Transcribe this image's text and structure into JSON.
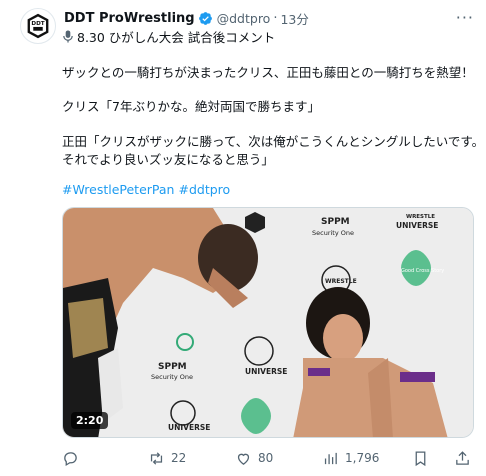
{
  "tweet": {
    "author_name": "DDT ProWrestling",
    "handle": "@ddtpro",
    "separator": "·",
    "time": "13分",
    "space_line": "8.30 ひがしん大会 試合後コメント",
    "lines": [
      "ザックとの一騎打ちが決まったクリス、正田も藤田との一騎打ちを熱望！",
      "クリス「7年ぶりかな。絶対両国で勝ちます」",
      "正田「クリスがザックに勝って、次は俺がこうくんとシングルしたいです。",
      "それでより良いズッ友になると思う」"
    ],
    "hashtags": [
      "#WrestlePeterPan",
      "#ddtpro"
    ],
    "video": {
      "duration": "2:20",
      "banner_texts": [
        "SPPM",
        "Security One",
        "WRESTLE",
        "UNIVERSE",
        "Good Cross Story"
      ]
    },
    "actions": {
      "reply_count": "",
      "retweet_count": "22",
      "like_count": "80",
      "views_count": "1,796"
    },
    "colors": {
      "link": "#1d9bf0",
      "muted": "#536471",
      "verified": "#1d9bf0"
    }
  }
}
